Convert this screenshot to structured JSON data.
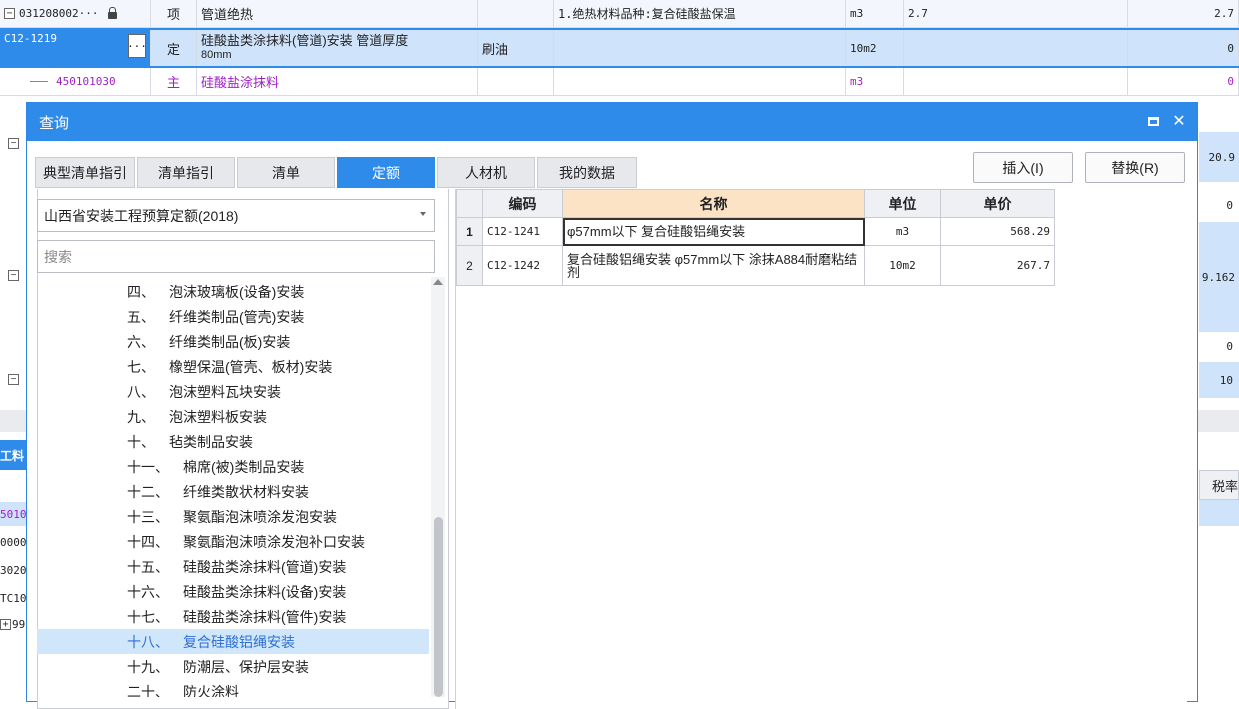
{
  "background": {
    "rows": [
      {
        "code": "031208002···",
        "type": "项",
        "name": "管道绝热",
        "feature": "1.绝热材料品种:复合硅酸盐保温",
        "unit": "m3",
        "qty": "2.7",
        "total": "2.7"
      },
      {
        "code": "C12-1219",
        "type": "定",
        "name": "硅酸盐类涂抹料(管道)安装 管道厚度",
        "name2": "80mm",
        "remark": "刷油",
        "unit": "10m2",
        "total": "0"
      },
      {
        "code": "450101030",
        "type": "主",
        "name": "硅酸盐涂抹料",
        "unit": "m3",
        "total": "0"
      }
    ],
    "side_values": [
      "20.9",
      "0",
      "9.162",
      "0",
      "10"
    ],
    "lower_label": "工料",
    "lower_header": "税率",
    "lower_codes": [
      "5010",
      "0000",
      "3020",
      "TC10",
      "99"
    ]
  },
  "dialog": {
    "title": "查询",
    "tabs": [
      "典型清单指引",
      "清单指引",
      "清单",
      "定额",
      "人材机",
      "我的数据"
    ],
    "active_tab": "定额",
    "insert_label": "插入(I)",
    "replace_label": "替换(R)",
    "quota_library": "山西省安装工程预算定额(2018)",
    "search_placeholder": "搜索",
    "tree": [
      {
        "num": "四、",
        "label": "泡沫玻璃板(设备)安装"
      },
      {
        "num": "五、",
        "label": "纤维类制品(管壳)安装"
      },
      {
        "num": "六、",
        "label": "纤维类制品(板)安装"
      },
      {
        "num": "七、",
        "label": "橡塑保温(管壳、板材)安装"
      },
      {
        "num": "八、",
        "label": "泡沫塑料瓦块安装"
      },
      {
        "num": "九、",
        "label": "泡沫塑料板安装"
      },
      {
        "num": "十、",
        "label": "毡类制品安装"
      },
      {
        "num": "十一、",
        "label": "棉席(被)类制品安装"
      },
      {
        "num": "十二、",
        "label": "纤维类散状材料安装"
      },
      {
        "num": "十三、",
        "label": "聚氨酯泡沫喷涂发泡安装"
      },
      {
        "num": "十四、",
        "label": "聚氨酯泡沫喷涂发泡补口安装"
      },
      {
        "num": "十五、",
        "label": "硅酸盐类涂抹料(管道)安装"
      },
      {
        "num": "十六、",
        "label": "硅酸盐类涂抹料(设备)安装"
      },
      {
        "num": "十七、",
        "label": "硅酸盐类涂抹料(管件)安装"
      },
      {
        "num": "十八、",
        "label": "复合硅酸铝绳安装"
      },
      {
        "num": "十九、",
        "label": "防潮层、保护层安装"
      },
      {
        "num": "二十、",
        "label": "防火涂料"
      }
    ],
    "selected_tree_index": 14,
    "table": {
      "headers": [
        "编码",
        "名称",
        "单位",
        "单价"
      ],
      "rows": [
        {
          "idx": "1",
          "code": "C12-1241",
          "name": "φ57mm以下 复合硅酸铝绳安装",
          "unit": "m3",
          "price": "568.29"
        },
        {
          "idx": "2",
          "code": "C12-1242",
          "name": "复合硅酸铝绳安装 φ57mm以下 涂抹A884耐磨粘结剂",
          "unit": "10m2",
          "price": "267.7"
        }
      ]
    }
  }
}
